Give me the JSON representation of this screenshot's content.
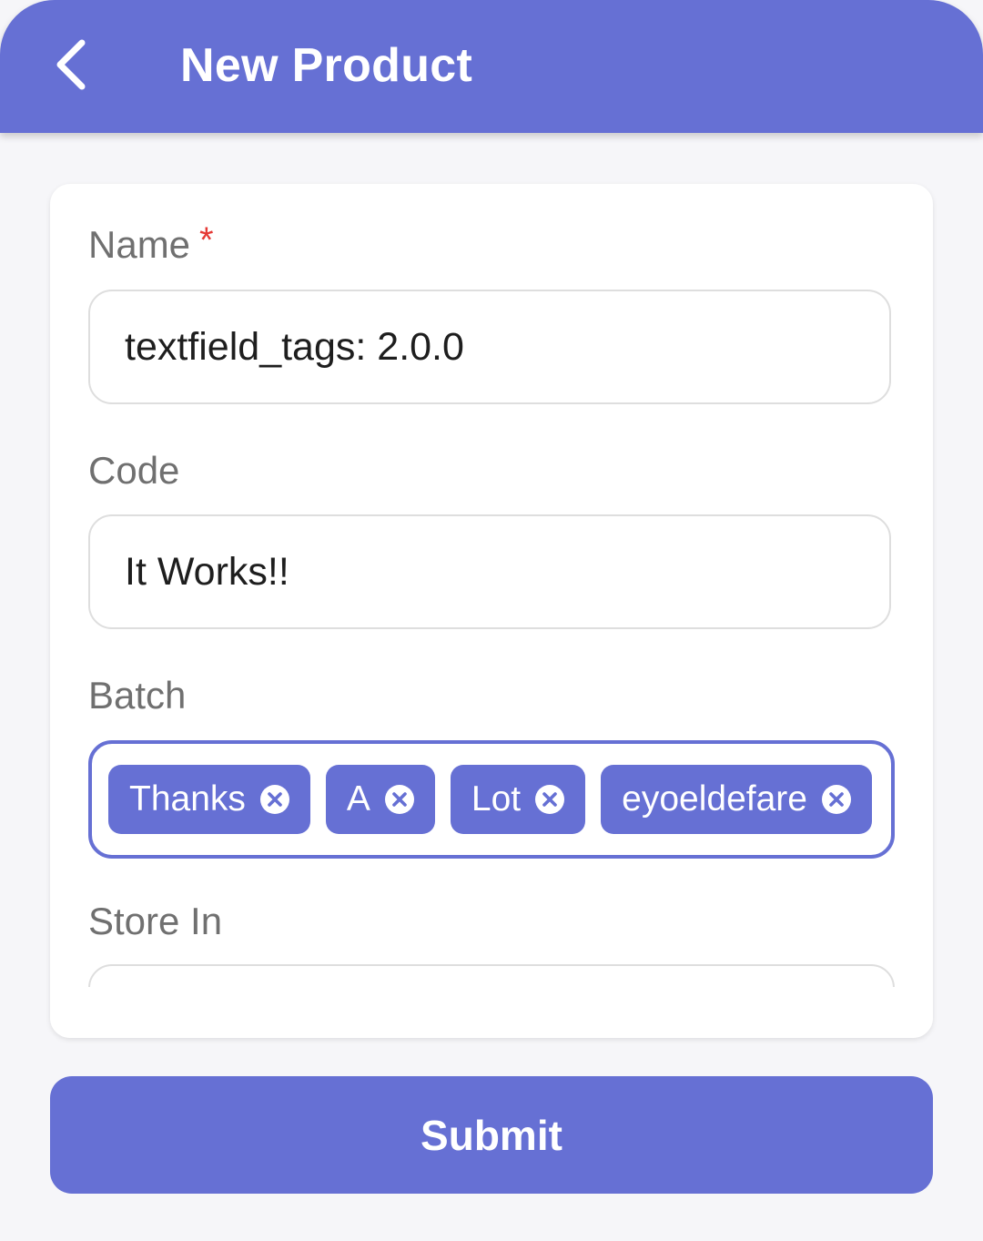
{
  "app_bar": {
    "title": "New Product",
    "back_icon": "chevron-left-icon",
    "background_color": "#6670d4"
  },
  "form": {
    "name": {
      "label": "Name",
      "required_marker": "*",
      "value": "textfield_tags: 2.0.0"
    },
    "code": {
      "label": "Code",
      "value": "It Works!!"
    },
    "batch": {
      "label": "Batch",
      "tags": [
        "Thanks",
        "A",
        "Lot",
        "eyoeldefare"
      ],
      "remove_icon": "close-circle-icon"
    },
    "store_in": {
      "label": "Store In",
      "value": ""
    }
  },
  "submit": {
    "label": "Submit"
  },
  "colors": {
    "accent": "#6670d4",
    "required": "#e53935",
    "label": "#707070",
    "background": "#f6f6f9"
  }
}
